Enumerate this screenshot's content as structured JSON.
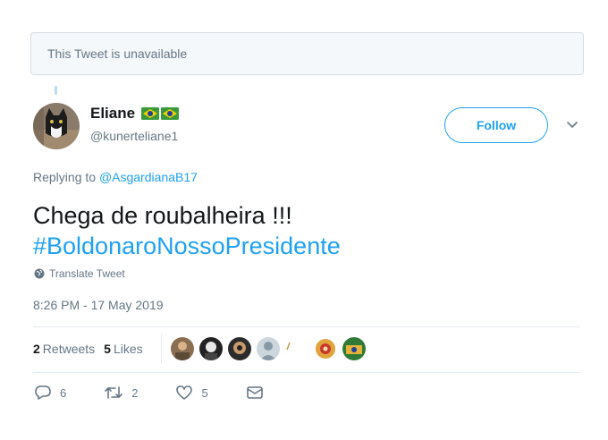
{
  "unavailable_notice": "This Tweet is unavailable",
  "author": {
    "name": "Eliane",
    "handle": "@kunerteliane1"
  },
  "follow_label": "Follow",
  "reply_context": {
    "prefix": "Replying to",
    "target": "@AsgardianaB17"
  },
  "tweet": {
    "text": "Chega de roubalheira !!!",
    "hashtag": "#BoldonaroNossoPresidente"
  },
  "translate_label": "Translate Tweet",
  "timestamp": "8:26 PM - 17 May 2019",
  "stats": {
    "retweets_count": "2",
    "retweets_label": "Retweets",
    "likes_count": "5",
    "likes_label": "Likes"
  },
  "actions": {
    "reply_count": "6",
    "retweet_count": "2",
    "like_count": "5"
  },
  "colors": {
    "accent": "#1da1f2",
    "secondary_text": "#657786",
    "primary_text": "#14171a"
  },
  "icons": [
    "brazil-flag-icon",
    "chevron-down-icon",
    "globe-icon",
    "reply-icon",
    "retweet-icon",
    "like-icon",
    "message-icon"
  ]
}
